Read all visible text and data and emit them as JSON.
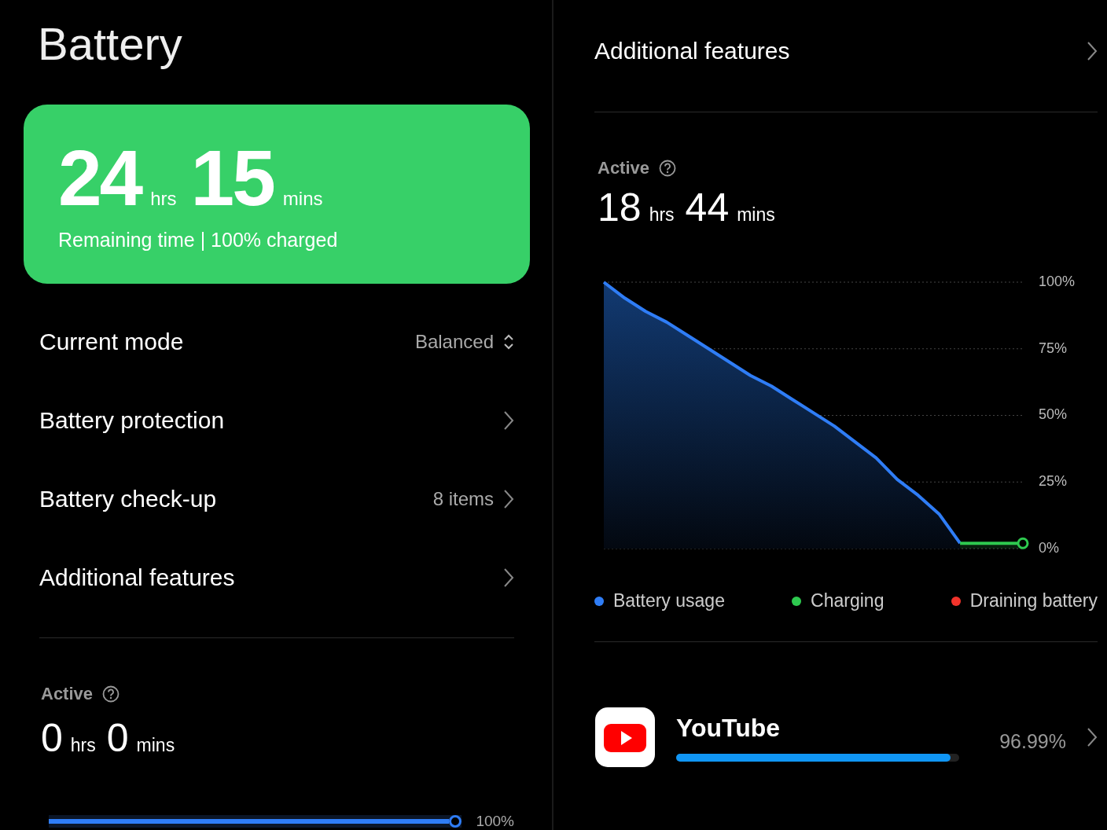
{
  "title": "Battery",
  "summary": {
    "hours": "24",
    "hours_unit": "hrs",
    "minutes": "15",
    "minutes_unit": "mins",
    "caption": "Remaining time | 100% charged"
  },
  "settings": [
    {
      "kind": "select",
      "label": "Current mode",
      "value": "Balanced"
    },
    {
      "kind": "link",
      "label": "Battery protection"
    },
    {
      "kind": "link",
      "label": "Battery check-up",
      "value": "8 items"
    },
    {
      "kind": "link",
      "label": "Additional features"
    }
  ],
  "left_active": {
    "label": "Active",
    "hours": "0",
    "hours_unit": "hrs",
    "minutes": "0",
    "minutes_unit": "mins",
    "level": 1,
    "reading": "100%"
  },
  "right_header": {
    "label": "Additional features"
  },
  "right_active": {
    "label": "Active",
    "hours": "18",
    "hours_unit": "hrs",
    "minutes": "44",
    "minutes_unit": "mins",
    "chart_data": {
      "type": "area",
      "grid": true,
      "categories": [
        null,
        null,
        null,
        null,
        null,
        null,
        null,
        null,
        null,
        null,
        null,
        null,
        null,
        null,
        null,
        null,
        null,
        null,
        null,
        null,
        null
      ],
      "ylim": [
        0,
        100
      ],
      "yticks": [
        {
          "value": 0,
          "label": "0%"
        },
        {
          "value": 25,
          "label": "25%"
        },
        {
          "value": 50,
          "label": "50%"
        },
        {
          "value": 75,
          "label": "75%"
        },
        {
          "value": 100,
          "label": "100%"
        }
      ],
      "series": [
        {
          "name": "Battery usage",
          "color": "#2f7df6",
          "values": [
            100,
            94,
            89,
            85,
            80,
            75,
            70,
            65,
            61,
            56,
            51,
            46,
            40,
            34,
            26,
            20,
            13,
            2,
            null,
            null,
            null
          ]
        },
        {
          "name": "Charging",
          "color": "#2ec94f",
          "values": [
            null,
            null,
            null,
            null,
            null,
            null,
            null,
            null,
            null,
            null,
            null,
            null,
            null,
            null,
            null,
            null,
            null,
            2,
            2,
            2,
            2
          ]
        }
      ]
    },
    "legend_extra": [
      {
        "label": "Draining battery",
        "color": "#f2332b"
      }
    ]
  },
  "apps": [
    {
      "name": "YouTube",
      "level": 0.97,
      "reading": "96.99%"
    }
  ]
}
